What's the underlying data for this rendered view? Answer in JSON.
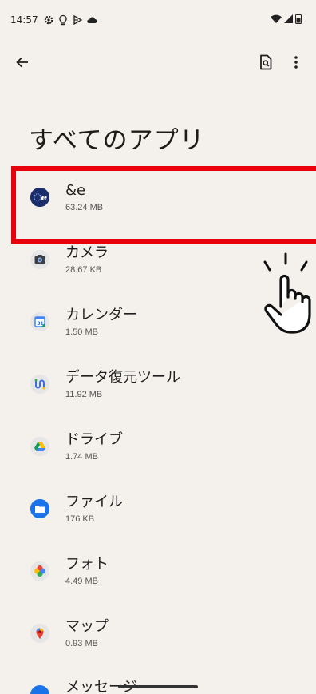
{
  "status_bar": {
    "time": "14:57",
    "icons": [
      "gear-icon",
      "lightbulb-icon",
      "play-icon",
      "cloud-icon"
    ],
    "right_icons": [
      "wifi-icon",
      "signal-icon",
      "battery-icon"
    ]
  },
  "top_bar": {
    "back_icon": "arrow-back-icon",
    "search_icon": "app-search-icon",
    "menu_icon": "more-vert-icon"
  },
  "page": {
    "title": "すべてのアプリ"
  },
  "apps": [
    {
      "name": "&e",
      "size": "63.24 MB",
      "icon": "andE-icon",
      "color": "#1b2d6b"
    },
    {
      "name": "カメラ",
      "size": "28.67 KB",
      "icon": "camera-icon",
      "color": "#3c4043"
    },
    {
      "name": "カレンダー",
      "size": "1.50 MB",
      "icon": "calendar-icon",
      "color": "#4285f4"
    },
    {
      "name": "データ復元ツール",
      "size": "11.92 MB",
      "icon": "data-restore-icon",
      "color": "#3c6fe4"
    },
    {
      "name": "ドライブ",
      "size": "1.74 MB",
      "icon": "drive-icon",
      "color": "#0f9d58"
    },
    {
      "name": "ファイル",
      "size": "176 KB",
      "icon": "files-icon",
      "color": "#1a73e8"
    },
    {
      "name": "フォト",
      "size": "4.49 MB",
      "icon": "photos-icon",
      "color": "#fbbc04"
    },
    {
      "name": "マップ",
      "size": "0.93 MB",
      "icon": "maps-icon",
      "color": "#ea4335"
    },
    {
      "name": "メッセージ",
      "size": "",
      "icon": "messages-icon",
      "color": "#1a73e8"
    }
  ],
  "colors": {
    "background": "#f4f1ec",
    "highlight": "#e8000b"
  }
}
